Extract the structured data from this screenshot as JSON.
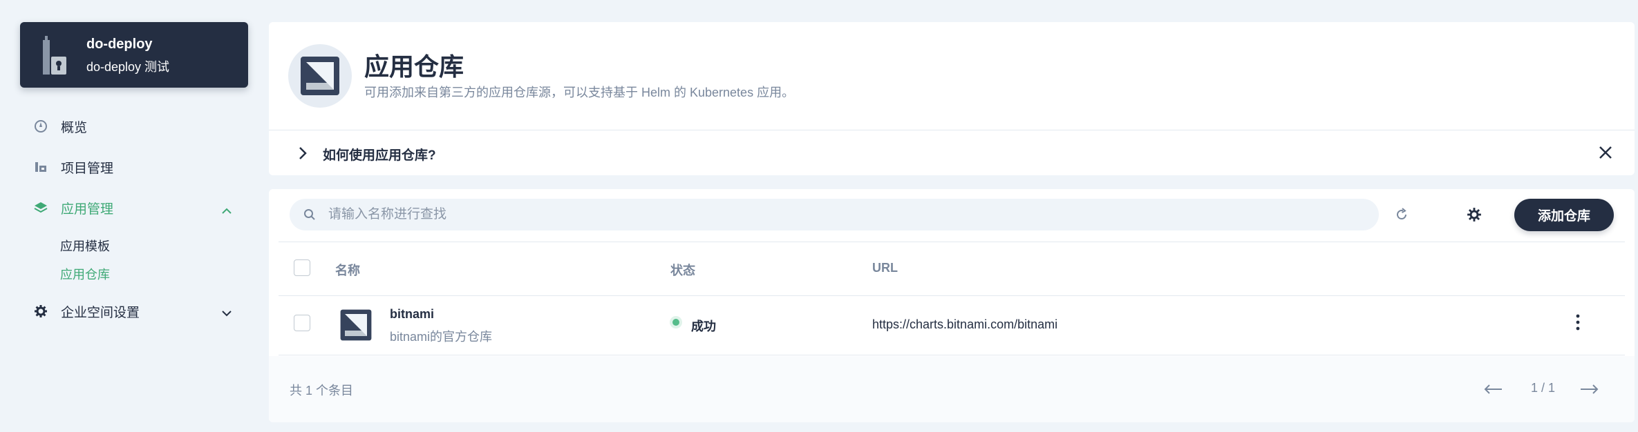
{
  "workspace": {
    "name": "do-deploy",
    "description": "do-deploy 测试"
  },
  "sidebar": {
    "items": [
      {
        "label": "概览",
        "icon": "dashboard-icon"
      },
      {
        "label": "项目管理",
        "icon": "project-icon"
      },
      {
        "label": "应用管理",
        "icon": "layers-icon",
        "expanded": true,
        "active": true,
        "children": [
          {
            "label": "应用模板",
            "active": false
          },
          {
            "label": "应用仓库",
            "active": true
          }
        ]
      },
      {
        "label": "企业空间设置",
        "icon": "gear-icon",
        "expanded": false
      }
    ]
  },
  "header": {
    "title": "应用仓库",
    "description": "可用添加来自第三方的应用仓库源，可以支持基于 Helm 的 Kubernetes 应用。",
    "howto_label": "如何使用应用仓库?"
  },
  "toolbar": {
    "search_placeholder": "请输入名称进行查找",
    "add_label": "添加仓库"
  },
  "table": {
    "columns": [
      "名称",
      "状态",
      "URL"
    ],
    "rows": [
      {
        "name": "bitnami",
        "description": "bitnami的官方仓库",
        "status": "成功",
        "url": "https://charts.bitnami.com/bitnami"
      }
    ]
  },
  "footer": {
    "total": "共 1 个条目",
    "page": "1 / 1"
  },
  "colors": {
    "dark": "#242e42",
    "accent": "#3fa976",
    "success": "#55bc8a",
    "background": "#eff4f9",
    "muted": "#79879c"
  }
}
